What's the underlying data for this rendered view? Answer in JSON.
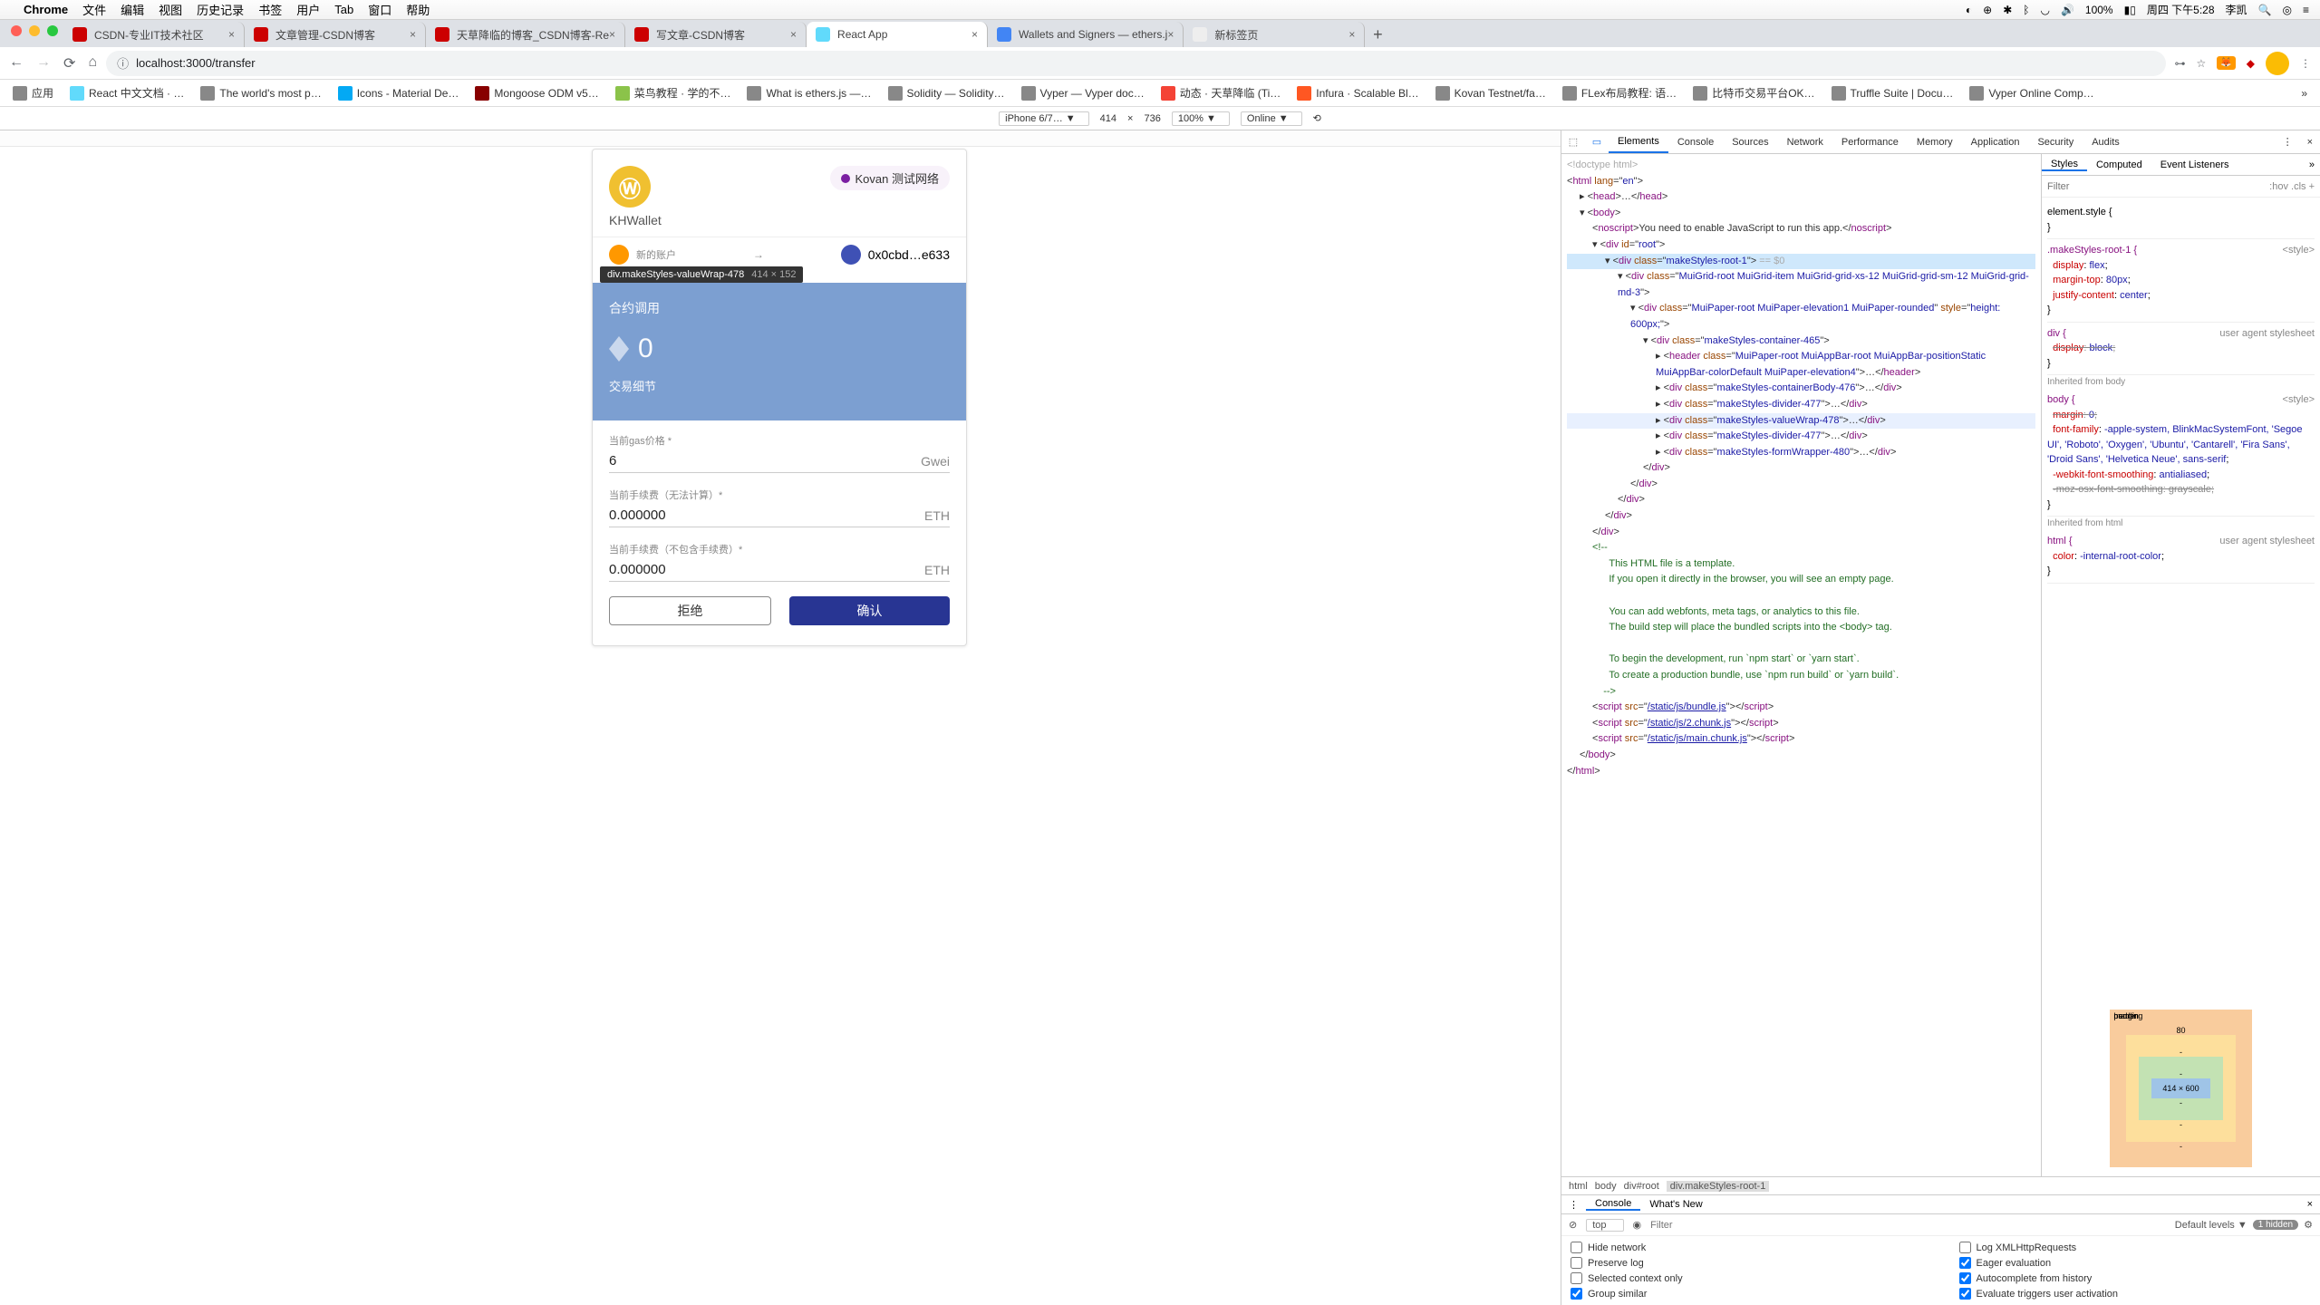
{
  "menubar": {
    "app": "Chrome",
    "items": [
      "文件",
      "编辑",
      "视图",
      "历史记录",
      "书签",
      "用户",
      "Tab",
      "窗口",
      "帮助"
    ],
    "right": [
      "100%",
      "周四 下午5:28",
      "李凯"
    ]
  },
  "tabs": [
    {
      "title": "CSDN-专业IT技术社区",
      "active": false
    },
    {
      "title": "文章管理-CSDN博客",
      "active": false
    },
    {
      "title": "天草降临的博客_CSDN博客-Re",
      "active": false
    },
    {
      "title": "写文章-CSDN博客",
      "active": false
    },
    {
      "title": "React App",
      "active": true
    },
    {
      "title": "Wallets and Signers — ethers.j",
      "active": false
    },
    {
      "title": "新标签页",
      "active": false
    }
  ],
  "url": "localhost:3000/transfer",
  "bookmarks": [
    "应用",
    "React 中文文档 · …",
    "The world's most p…",
    "Icons - Material De…",
    "Mongoose ODM v5…",
    "菜鸟教程 · 学的不…",
    "What is ethers.js —…",
    "Solidity — Solidity…",
    "Vyper — Vyper doc…",
    "动态 · 天草降临 (Ti…",
    "Infura · Scalable Bl…",
    "Kovan Testnet/fa…",
    "FLex布局教程: 语…",
    "比特币交易平台OK…",
    "Truffle Suite | Docu…",
    "Vyper Online Comp…"
  ],
  "devbar": {
    "device": "iPhone 6/7… ▼",
    "w": "414",
    "h": "736",
    "zoom": "100% ▼",
    "online": "Online ▼"
  },
  "app": {
    "brand": "KHWallet",
    "network": "Kovan 测试网络",
    "accountLabelSmall": "新的账户",
    "address": "0x0cbd…e633",
    "tooltip": {
      "sel": "div.makeStyles-valueWrap-478",
      "dim": "414 × 152"
    },
    "section1": "合约调用",
    "ethValue": "0",
    "section2": "交易细节",
    "fields": [
      {
        "label": "当前gas价格 *",
        "value": "6",
        "unit": "Gwei"
      },
      {
        "label": "当前手续费（无法计算）*",
        "value": "0.000000",
        "unit": "ETH"
      },
      {
        "label": "当前手续费（不包含手续费）*",
        "value": "0.000000",
        "unit": "ETH"
      }
    ],
    "buttons": {
      "cancel": "拒绝",
      "confirm": "确认"
    }
  },
  "dev": {
    "tabs": [
      "Elements",
      "Console",
      "Sources",
      "Network",
      "Performance",
      "Memory",
      "Application",
      "Security",
      "Audits"
    ],
    "stylesTabs": [
      "Styles",
      "Computed",
      "Event Listeners"
    ],
    "filter": "Filter",
    "filterExtra": ":hov .cls +",
    "rules": {
      "elStyle": "element.style {",
      "r1": {
        "sel": ".makeStyles-root-1 {",
        "src": "<style>",
        "props": [
          [
            "display",
            "flex"
          ],
          [
            "margin-top",
            "80px"
          ],
          [
            "justify-content",
            "center"
          ]
        ]
      },
      "r2": {
        "sel": "div {",
        "src": "user agent stylesheet",
        "props": [
          [
            "display",
            "block"
          ]
        ],
        "strike": true
      },
      "inh1": "Inherited from body",
      "r3": {
        "sel": "body {",
        "src": "<style>",
        "props": [
          [
            "margin",
            "0"
          ],
          [
            "font-family",
            "-apple-system, BlinkMacSystemFont, 'Segoe UI', 'Roboto', 'Oxygen', 'Ubuntu', 'Cantarell', 'Fira Sans', 'Droid Sans', 'Helvetica Neue', sans-serif"
          ],
          [
            "-webkit-font-smoothing",
            "antialiased"
          ]
        ]
      },
      "inh2": "Inherited from html",
      "r4": {
        "sel": "html {",
        "src": "user agent stylesheet",
        "props": [
          [
            "color",
            "-internal-root-color"
          ]
        ]
      }
    },
    "box": {
      "margin": "margin",
      "marginTop": "80",
      "border": "border",
      "padding": "padding",
      "content": "414 × 600"
    },
    "crumbs": [
      "html",
      "body",
      "div#root",
      "div.makeStyles-root-1"
    ],
    "consoleTabs": [
      "Console",
      "What's New"
    ],
    "consoleTb": {
      "ctx": "top",
      "filter": "Filter",
      "levels": "Default levels ▼",
      "hidden": "1 hidden"
    },
    "consoleOpts": [
      [
        "Hide network",
        false
      ],
      [
        "Log XMLHttpRequests",
        false
      ],
      [
        "Preserve log",
        false
      ],
      [
        "Eager evaluation",
        true
      ],
      [
        "Selected context only",
        false
      ],
      [
        "Autocomplete from history",
        true
      ],
      [
        "Group similar",
        true
      ],
      [
        "Evaluate triggers user activation",
        true
      ]
    ],
    "html": {
      "doctype": "<!doctype html>",
      "htmlOpen": "<html lang=\"en\">",
      "head": "<head>…</head>",
      "body": "<body>",
      "noscript": "<noscript>You need to enable JavaScript to run this app.</noscript>",
      "root": "<div id=\"root\">",
      "root1": "<div class=\"makeStyles-root-1\"> == $0",
      "grid": "<div class=\"MuiGrid-root MuiGrid-item MuiGrid-grid-xs-12 MuiGrid-grid-sm-12 MuiGrid-grid-md-3\">",
      "paper": "<div class=\"MuiPaper-root MuiPaper-elevation1 MuiPaper-rounded\" style=\"height: 600px;\">",
      "container": "<div class=\"makeStyles-container-465\">",
      "appbar": "<header class=\"MuiPaper-root MuiAppBar-root MuiAppBar-positionStatic MuiAppBar-colorDefault MuiPaper-elevation4\">…</header>",
      "body476": "<div class=\"makeStyles-containerBody-476\">…</div>",
      "div477a": "<div class=\"makeStyles-divider-477\">…</div>",
      "div478": "<div class=\"makeStyles-valueWrap-478\">…</div>",
      "div477b": "<div class=\"makeStyles-divider-477\">…</div>",
      "div480": "<div class=\"makeStyles-formWrapper-480\">…</div>",
      "comment": "This HTML file is a template.\n      If you open it directly in the browser, you will see an empty page.\n\n      You can add webfonts, meta tags, or analytics to this file.\n      The build step will place the bundled scripts into the <body> tag.\n\n      To begin the development, run `npm start` or `yarn start`.\n      To create a production bundle, use `npm run build` or `yarn build`.",
      "s1": "/static/js/bundle.js",
      "s2": "/static/js/2.chunk.js",
      "s3": "/static/js/main.chunk.js"
    }
  }
}
